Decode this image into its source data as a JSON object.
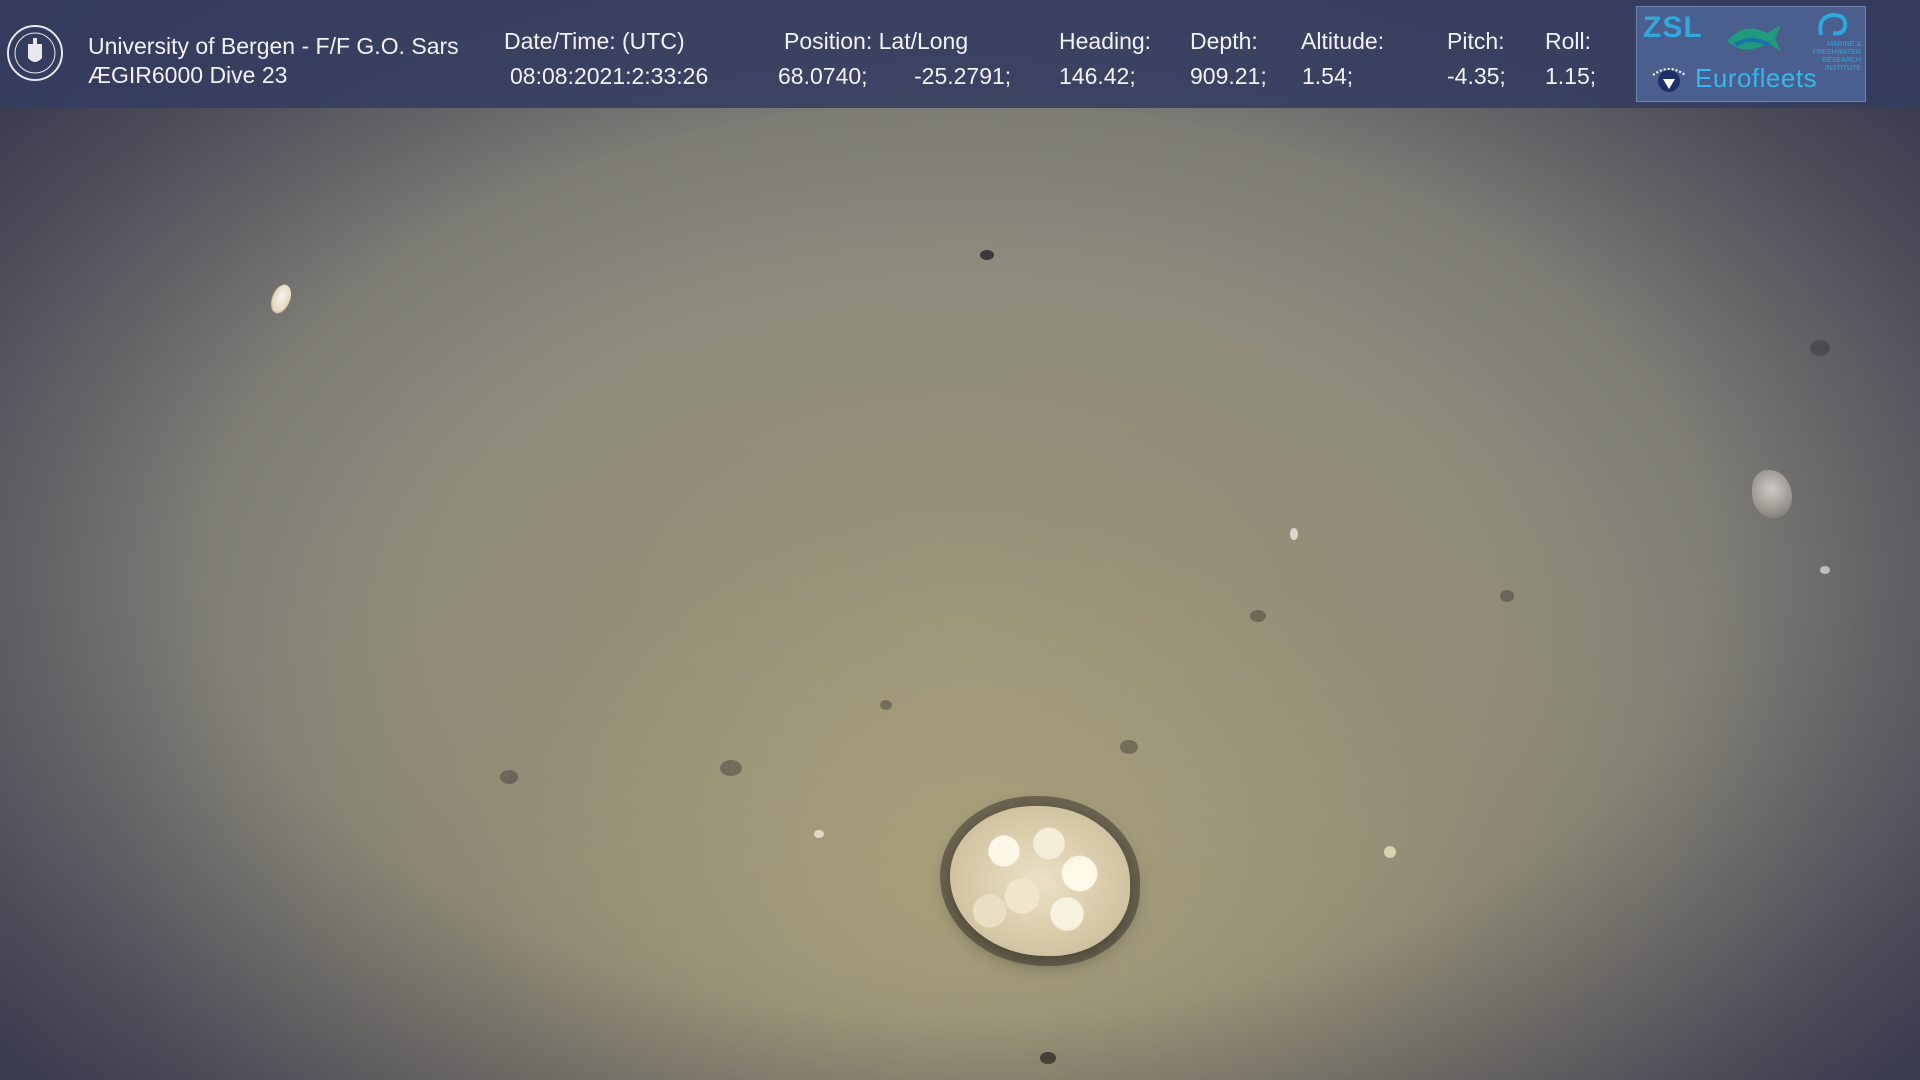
{
  "overlay": {
    "institution": "University of Bergen - F/F G.O. Sars",
    "dive": "ÆGIR6000 Dive 23",
    "datetime_label": "Date/Time: (UTC)",
    "datetime_value": "08:08:2021:2:33:26",
    "position_label": "Position: Lat/Long",
    "lat_value": "68.0740;",
    "long_value": "-25.2791;",
    "heading_label": "Heading:",
    "heading_value": "146.42;",
    "depth_label": "Depth:",
    "depth_value": "909.21;",
    "altitude_label": "Altitude:",
    "altitude_value": "1.54;",
    "pitch_label": "Pitch:",
    "pitch_value": "-4.35;",
    "roll_label": "Roll:",
    "roll_value": "1.15;"
  },
  "logos": {
    "zsl": "ZSL",
    "mfri_text": "MARINE & FRESHWATER RESEARCH INSTITUTE",
    "eurofleets": "Eurofleets"
  },
  "colors": {
    "overlay_bg": "#343c60",
    "overlay_text": "#f2f2f6",
    "logo_blue": "#2ea9e0",
    "seafloor": "#9a9683"
  },
  "icons": [
    "university-seal-icon",
    "fish-logo-icon",
    "globe-logo-icon",
    "swirl-logo-icon"
  ]
}
